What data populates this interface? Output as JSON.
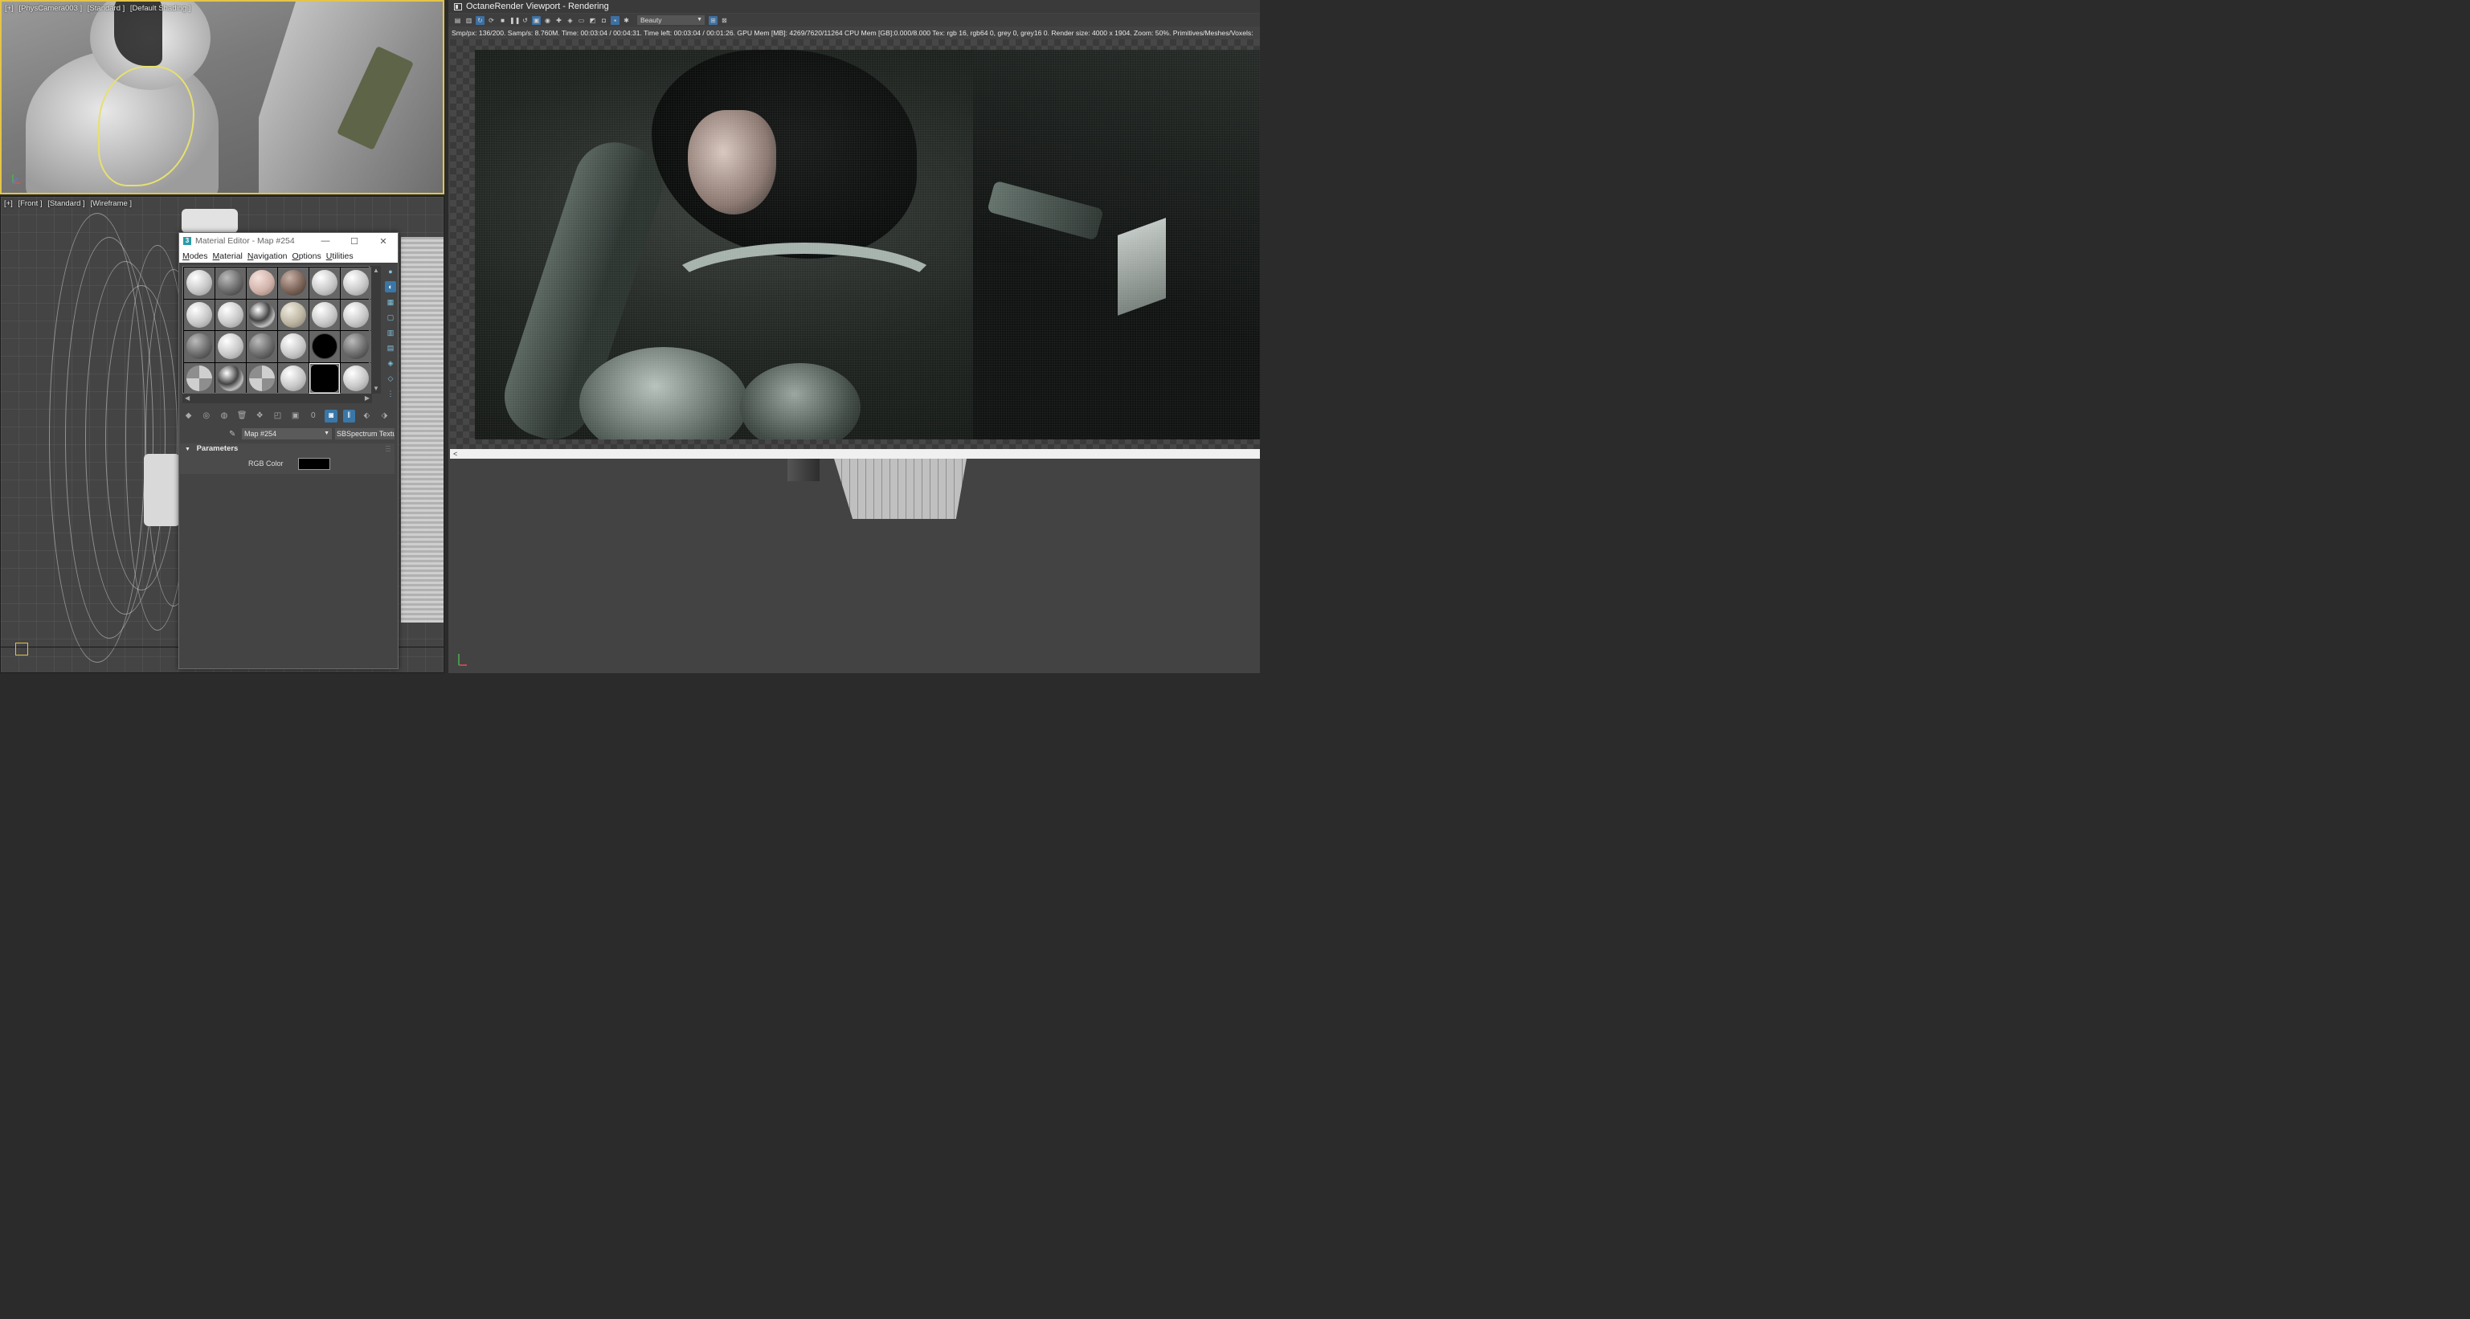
{
  "viewports": {
    "camera": {
      "labels": [
        "[+]",
        "[PhysCamera003 ]",
        "[Standard ]",
        "[Default Shading ]"
      ]
    },
    "front": {
      "labels": [
        "[+]",
        "[Front ]",
        "[Standard ]",
        "[Wireframe ]"
      ]
    }
  },
  "material_editor": {
    "title": "Material Editor - Map #254",
    "app_icon": "3",
    "window_buttons": {
      "minimize": "—",
      "maximize": "☐",
      "close": "✕"
    },
    "menus": [
      "Modes",
      "Material",
      "Navigation",
      "Options",
      "Utilities"
    ],
    "map_name": "Map #254",
    "map_type": "SBSpectrum Textu",
    "rollout_title": "Parameters",
    "rgb_color_label": "RGB Color",
    "rgb_color_value": "#000000"
  },
  "octane": {
    "title": "OctaneRender Viewport - Rendering",
    "render_pass": "Beauty",
    "stats": "Smp/px: 136/200.  Samp/s: 8.760M.  Time: 00:03:04 / 00:04:31.  Time left: 00:03:04 / 00:01:26.  GPU Mem [MB]: 4269/7620/11264  CPU Mem [GB]:0.000/8.000  Tex: rgb 16, rgb64 0, grey 0, grey16 0.  Render size: 4000 x 1904.  Zoom: 50%.  Primitives/Meshes/Voxels:",
    "scroll_left": "<"
  }
}
